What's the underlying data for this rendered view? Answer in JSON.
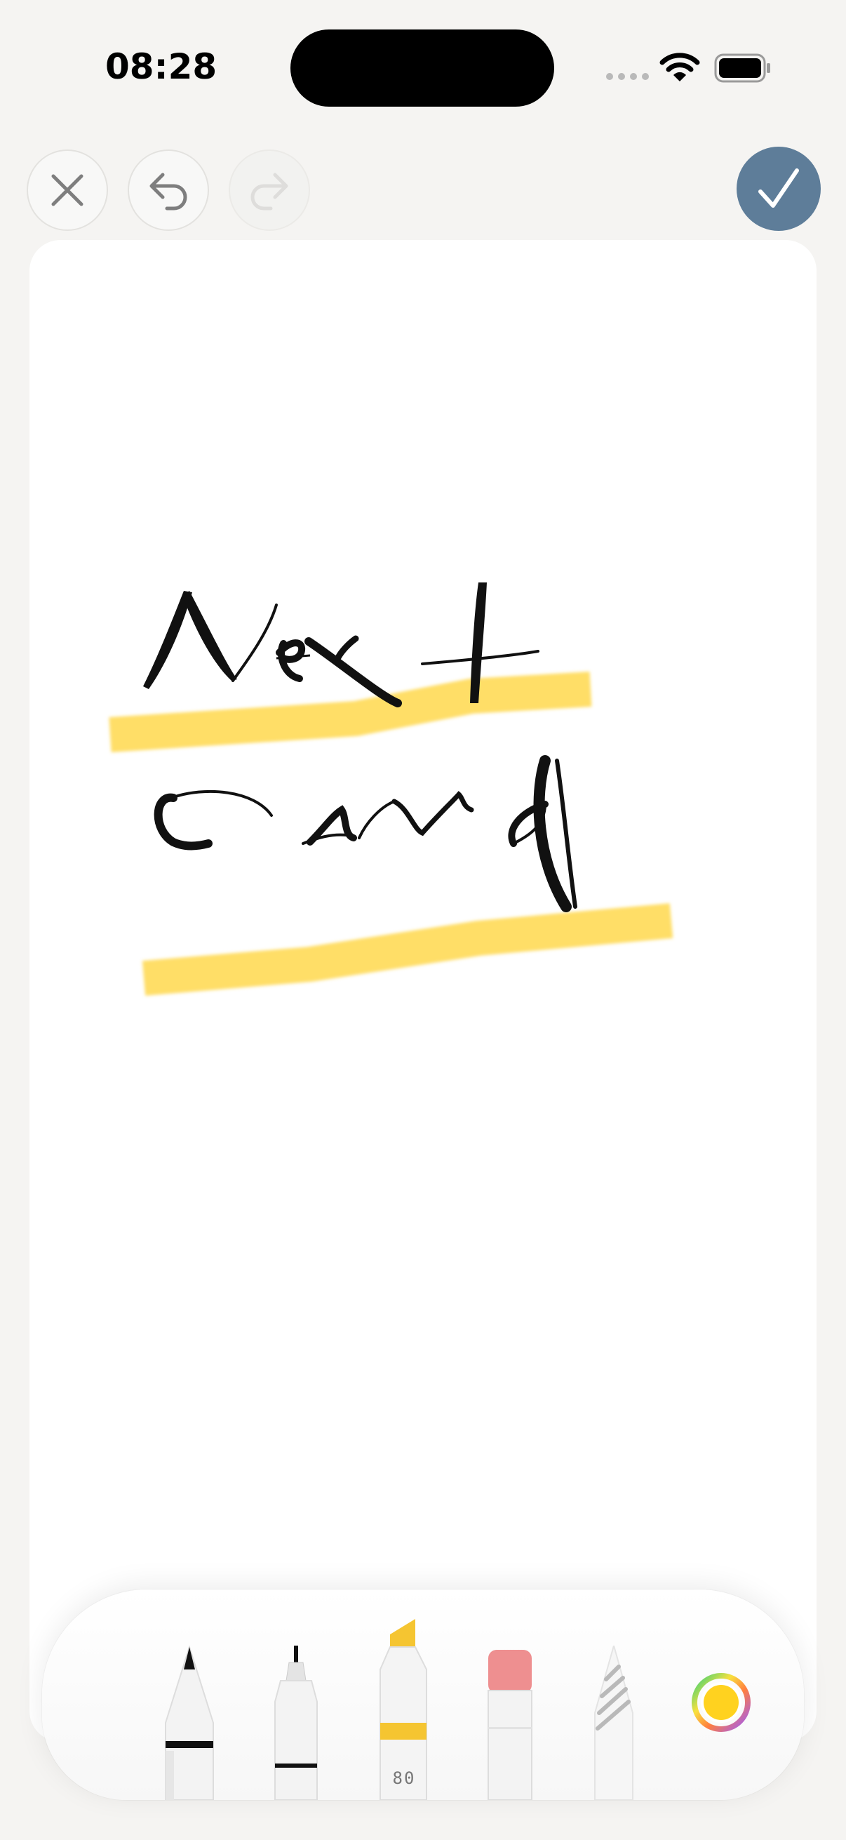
{
  "status_bar": {
    "time": "08:28",
    "icons": [
      "cellular-dots-icon",
      "wifi-icon",
      "battery-icon"
    ]
  },
  "toolbar": {
    "close_icon": "close-icon",
    "undo_icon": "undo-icon",
    "redo_icon": "redo-icon",
    "redo_enabled": false,
    "done_icon": "checkmark-icon",
    "accent_color": "#5e7d99"
  },
  "canvas": {
    "handwriting": [
      "Next",
      "Card"
    ],
    "ink_color": "#111111",
    "highlight_color": "#ffd84d"
  },
  "tools": {
    "items": [
      "pen",
      "fineliner",
      "marker",
      "eraser",
      "lasso"
    ],
    "marker_opacity_label": "80",
    "selected_color": "#ffd21f",
    "color_picker_icon": "color-wheel-icon"
  }
}
